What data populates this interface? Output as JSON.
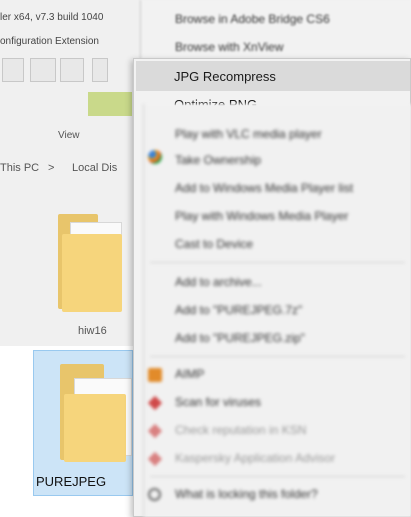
{
  "background": {
    "title_fragment": "ler x64, v7.3 build 1040",
    "menu_fragment": "onfiguration  Extension",
    "crumbs": [
      "This PC",
      ">",
      "Local Dis"
    ],
    "view_label": "View",
    "folder_left_label": "hiw16",
    "folder_selected_label": "PUREJPEG"
  },
  "menu_back": {
    "items": [
      "Browse in Adobe Bridge CS6",
      "Browse with XnView"
    ]
  },
  "menu_front": {
    "items": [
      "JPG Recompress",
      "Optimize PNG"
    ]
  },
  "menu_blurred": {
    "items": [
      "Play with VLC media player",
      "Take Ownership",
      "Add to Windows Media Player list",
      "Play with Windows Media Player",
      "Cast to Device",
      "Add to archive...",
      "Add to \"PUREJPEG.7z\"",
      "Add to \"PUREJPEG.zip\"",
      "AIMP",
      "Scan for viruses",
      "Check reputation in KSN",
      "Kaspersky Application Advisor",
      "What is locking this folder?"
    ]
  },
  "colors": {
    "highlight": "#dadada",
    "selection": "#cce4f7",
    "folder": "#f6d57c"
  }
}
